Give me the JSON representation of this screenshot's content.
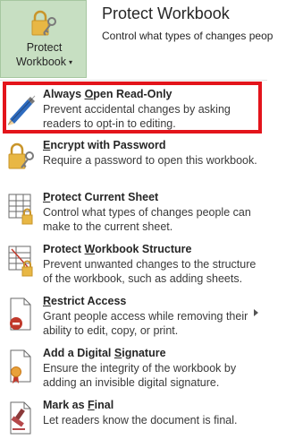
{
  "header": {
    "button_line1": "Protect",
    "button_line2": "Workbook",
    "title": "Protect Workbook",
    "subtitle": "Control what types of changes peop"
  },
  "menu": [
    {
      "title_pre": "Always ",
      "title_u": "O",
      "title_post": "pen Read-Only",
      "desc1": "Prevent accidental changes by asking",
      "desc2": "readers to opt-in to editing.",
      "icon": "pencil-icon"
    },
    {
      "title_pre": "",
      "title_u": "E",
      "title_post": "ncrypt with Password",
      "desc1": "Require a password to open this workbook.",
      "desc2": "",
      "icon": "lock-key-icon"
    },
    {
      "title_pre": "",
      "title_u": "P",
      "title_post": "rotect Current Sheet",
      "desc1": "Control what types of changes people can",
      "desc2": "make to the current sheet.",
      "icon": "sheet-lock-icon"
    },
    {
      "title_pre": "Protect ",
      "title_u": "W",
      "title_post": "orkbook Structure",
      "desc1": "Prevent unwanted changes to the structure",
      "desc2": "of the workbook, such as adding sheets.",
      "icon": "structure-lock-icon"
    },
    {
      "title_pre": "",
      "title_u": "R",
      "title_post": "estrict Access",
      "desc1": "Grant people access while removing their",
      "desc2": "ability to edit, copy, or print.",
      "icon": "restrict-icon"
    },
    {
      "title_pre": "Add a Digital ",
      "title_u": "S",
      "title_post": "ignature",
      "desc1": "Ensure the integrity of the workbook by",
      "desc2": "adding an invisible digital signature.",
      "icon": "signature-ribbon-icon"
    },
    {
      "title_pre": "Mark as ",
      "title_u": "F",
      "title_post": "inal",
      "desc1": "Let readers know the document is final.",
      "desc2": "",
      "icon": "final-stamp-icon"
    }
  ],
  "colors": {
    "button_bg": "#c7dfc2",
    "highlight_border": "#e3141b",
    "lock_gold": "#e8b744",
    "restrict_red": "#c0392b"
  }
}
